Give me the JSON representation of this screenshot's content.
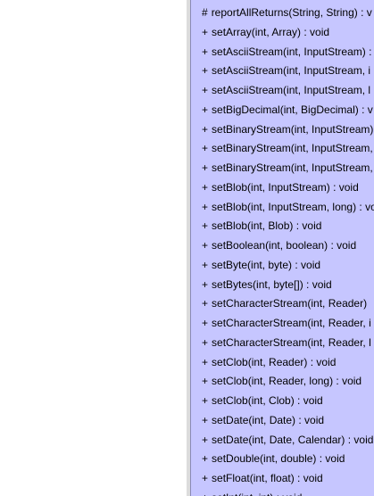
{
  "diagram": {
    "class_box": {
      "fill": "#c6c6ff",
      "border": "#8a8ab6",
      "methods": [
        {
          "visibility": "#",
          "signature": "reportAllReturns(String, String) : v"
        },
        {
          "visibility": "+",
          "signature": "setArray(int, Array) : void"
        },
        {
          "visibility": "+",
          "signature": "setAsciiStream(int, InputStream) :"
        },
        {
          "visibility": "+",
          "signature": "setAsciiStream(int, InputStream, i"
        },
        {
          "visibility": "+",
          "signature": "setAsciiStream(int, InputStream, l"
        },
        {
          "visibility": "+",
          "signature": "setBigDecimal(int, BigDecimal) : v"
        },
        {
          "visibility": "+",
          "signature": "setBinaryStream(int, InputStream)"
        },
        {
          "visibility": "+",
          "signature": "setBinaryStream(int, InputStream,"
        },
        {
          "visibility": "+",
          "signature": "setBinaryStream(int, InputStream,"
        },
        {
          "visibility": "+",
          "signature": "setBlob(int, InputStream) : void"
        },
        {
          "visibility": "+",
          "signature": "setBlob(int, InputStream, long) : vo"
        },
        {
          "visibility": "+",
          "signature": "setBlob(int, Blob) : void"
        },
        {
          "visibility": "+",
          "signature": "setBoolean(int, boolean) : void"
        },
        {
          "visibility": "+",
          "signature": "setByte(int, byte) : void"
        },
        {
          "visibility": "+",
          "signature": "setBytes(int, byte[]) : void"
        },
        {
          "visibility": "+",
          "signature": "setCharacterStream(int, Reader)"
        },
        {
          "visibility": "+",
          "signature": "setCharacterStream(int, Reader, i"
        },
        {
          "visibility": "+",
          "signature": "setCharacterStream(int, Reader, l"
        },
        {
          "visibility": "+",
          "signature": "setClob(int, Reader) : void"
        },
        {
          "visibility": "+",
          "signature": "setClob(int, Reader, long) : void"
        },
        {
          "visibility": "+",
          "signature": "setClob(int, Clob) : void"
        },
        {
          "visibility": "+",
          "signature": "setDate(int, Date) : void"
        },
        {
          "visibility": "+",
          "signature": "setDate(int, Date, Calendar) : void"
        },
        {
          "visibility": "+",
          "signature": "setDouble(int, double) : void"
        },
        {
          "visibility": "+",
          "signature": "setFloat(int, float) : void"
        },
        {
          "visibility": "+",
          "signature": "setInt(int, int) : void"
        }
      ]
    }
  }
}
